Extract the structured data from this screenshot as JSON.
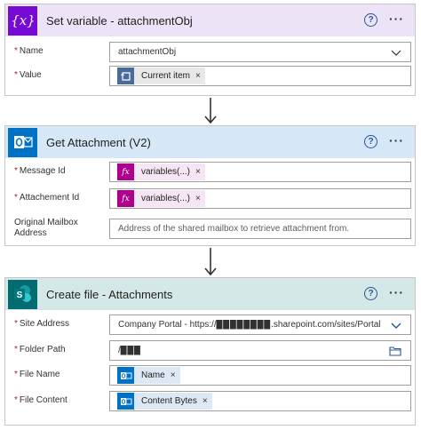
{
  "set_variable": {
    "title": "Set variable - attachmentObj",
    "help_symbol": "?",
    "more_symbol": "···",
    "name_label": "Name",
    "name_value": "attachmentObj",
    "value_label": "Value",
    "value_token": "Current item",
    "token_close": "×"
  },
  "get_attachment": {
    "title": "Get Attachment (V2)",
    "help_symbol": "?",
    "more_symbol": "···",
    "message_id_label": "Message Id",
    "message_id_token": "variables(...)",
    "attachment_id_label": "Attachement Id",
    "attachment_id_token": "variables(...)",
    "mailbox_label": "Original Mailbox Address",
    "mailbox_placeholder": "Address of the shared mailbox to retrieve attachment from.",
    "token_close": "×",
    "fx_symbol": "fx"
  },
  "create_file": {
    "title": "Create file - Attachments",
    "help_symbol": "?",
    "more_symbol": "···",
    "site_address_label": "Site Address",
    "site_address_value": "Company Portal - https://▉▉▉▉▉▉▉▉.sharepoint.com/sites/Portal",
    "folder_path_label": "Folder Path",
    "folder_path_value": "/▉▉▉",
    "file_name_label": "File Name",
    "file_name_token": "Name",
    "file_content_label": "File Content",
    "file_content_token": "Content Bytes",
    "token_close": "×"
  },
  "required_marker": "*",
  "colors": {
    "set_variable_header": "#ece3f7",
    "set_variable_accent": "#770bd6",
    "get_attachment_header": "#d6e8f7",
    "outlook_blue": "#0072c6",
    "create_file_header": "#d5e8e8",
    "sharepoint_teal": "#036c70",
    "fx_pink": "#ad008c",
    "variable_token_blue": "#4a6a9b",
    "help_blue": "#2b5797"
  }
}
